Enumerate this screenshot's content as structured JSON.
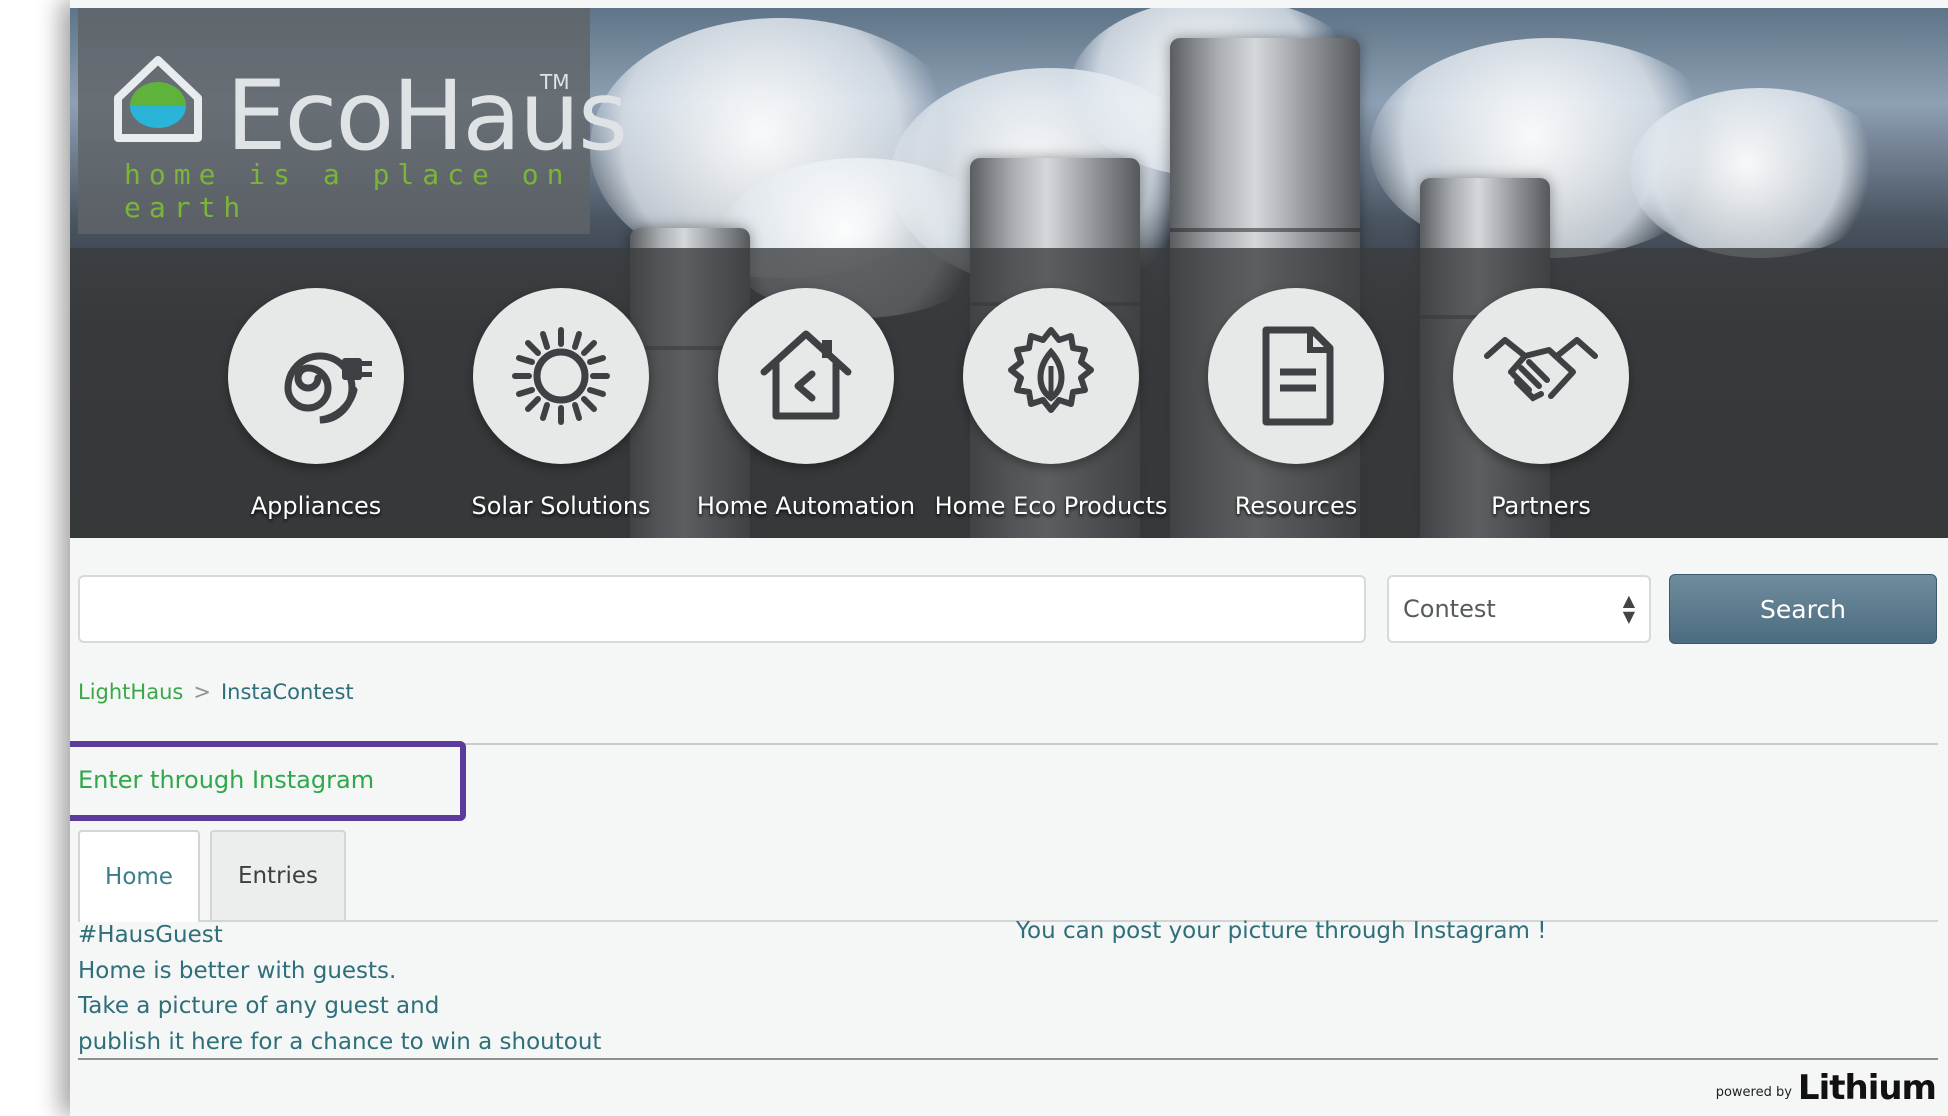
{
  "brand": {
    "name": "EcoHaus",
    "trademark": "TM",
    "tagline": "home is a place on earth"
  },
  "nav": {
    "items": [
      {
        "label": "Appliances",
        "icon": "plug-cord-icon"
      },
      {
        "label": "Solar Solutions",
        "icon": "sun-icon"
      },
      {
        "label": "Home Automation",
        "icon": "smart-home-icon"
      },
      {
        "label": "Home Eco Products",
        "icon": "eco-leaf-gear-icon"
      },
      {
        "label": "Resources",
        "icon": "document-icon"
      },
      {
        "label": "Partners",
        "icon": "handshake-icon"
      }
    ]
  },
  "search": {
    "value": "",
    "scope_selected": "Contest",
    "button_label": "Search"
  },
  "breadcrumb": {
    "items": [
      "LightHaus",
      "InstaContest"
    ],
    "separator": ">"
  },
  "enter_link": "Enter through Instagram",
  "tabs": [
    {
      "label": "Home",
      "active": true
    },
    {
      "label": "Entries",
      "active": false
    }
  ],
  "content": {
    "left_lines": [
      "#HausGuest",
      "Home is better with guests.",
      "Take a picture of any guest and",
      "publish it here for a chance to win a shoutout"
    ],
    "right_text": "You can post your picture through Instagram !"
  },
  "footer": {
    "powered_by": "powered by",
    "vendor": "Lithium"
  },
  "colors": {
    "accent_green": "#2fa84a",
    "link_teal": "#2e6f7a",
    "search_button": "#5a7a8c",
    "highlight_purple": "#5b3c9a"
  }
}
